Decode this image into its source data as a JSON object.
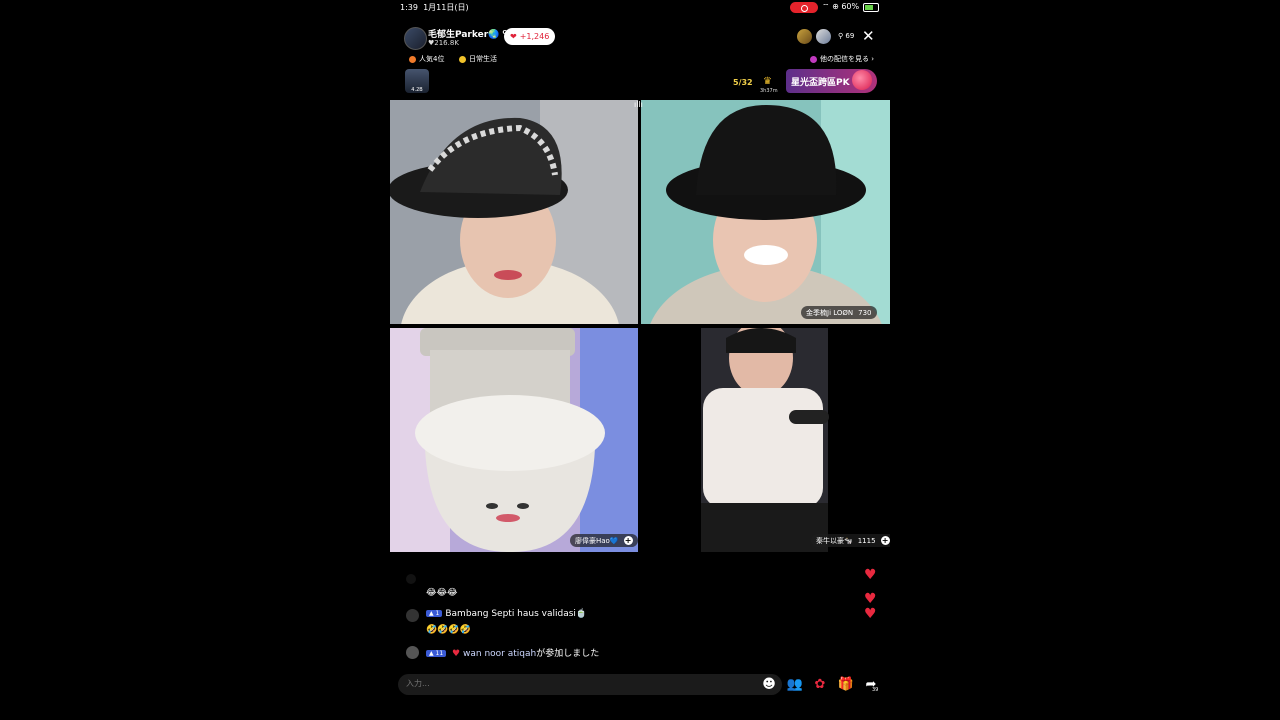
{
  "status_bar": {
    "time": "1:39",
    "date": "1月11日(日)",
    "battery": "60%",
    "record_color": "#e5232b"
  },
  "host": {
    "name": "毛郁生Parker🌏 ᴼᴼᴼ",
    "likes": "♥216.8K",
    "like_pill": "+1,246"
  },
  "header": {
    "viewer_count": "69",
    "close_icon": "close-icon"
  },
  "badges": {
    "rank": "人気4位",
    "category": "日常生活",
    "other_streams": "他の配信を見る ›"
  },
  "pk": {
    "mini_avatar_number": "4.2B",
    "score": "5/32",
    "timer": "3h37m",
    "banner": "星光盃跨區PK",
    "accent": "#b0327a"
  },
  "tiles": {
    "top_left": {
      "label": ""
    },
    "top_right": {
      "label": "金季楠Ji LOØN",
      "score": "730"
    },
    "bottom_left": {
      "label": "廖偉豪Hao💙"
    },
    "bottom_right": {
      "label": "秦牛以豪🐄",
      "score": "1115"
    }
  },
  "chat": [
    {
      "user": "",
      "text": "😂😂😂",
      "level": ""
    },
    {
      "user": "Bambang Septi haus validasi🍵",
      "text": "🤣🤣🤣🤣",
      "level": "1"
    },
    {
      "user": "wan noor atiqah",
      "text": "が参加しました",
      "level": "11"
    }
  ],
  "input": {
    "placeholder": "入力..."
  },
  "toolbar": {
    "emoji_icon": "emoji-icon",
    "guests_icon": "guests-icon",
    "rose_icon": "rose-icon",
    "gift_icon": "gift-icon",
    "share_icon": "share-icon",
    "share_count": "39"
  },
  "colors": {
    "heart": "#e8293f",
    "pill_text": "#e0233a",
    "level_badge": "#3b5bd6"
  }
}
